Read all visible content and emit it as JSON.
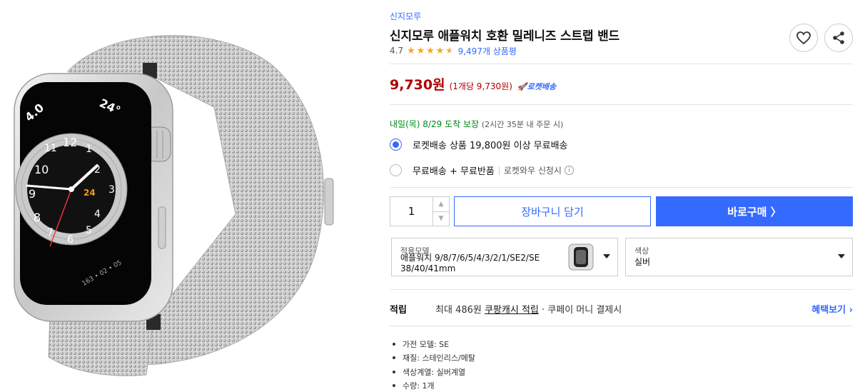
{
  "product": {
    "brand": "신지모루",
    "title": "신지모루 애플워치 호환 밀레니즈 스트랩 밴드",
    "rating": "4.7",
    "rating_value": 4.7,
    "review_count": "9,497개 상품평",
    "price": "9,730원",
    "unit_price": "(1개당 9,730원)",
    "rocket_badge": "로켓배송"
  },
  "delivery": {
    "date": "내일(목) 8/29",
    "guarantee": "도착 보장",
    "note": "(2시간 35분 내 주문 시)"
  },
  "shipping_options": [
    {
      "label": "로켓배송 상품 19,800원 이상 무료배송",
      "selected": true
    },
    {
      "label": "무료배송 + 무료반품",
      "extra": "로켓와우 신청시",
      "selected": false
    }
  ],
  "purchase": {
    "quantity": "1",
    "cart_label": "장바구니 담기",
    "buy_label": "바로구매 〉"
  },
  "options": {
    "model": {
      "label": "적용모델",
      "value_line1": "애플워치 9/8/7/6/5/4/3/2/1/SE2/SE",
      "value_line2": "38/40/41mm"
    },
    "color": {
      "label": "색상",
      "value": "실버"
    }
  },
  "benefit": {
    "label": "적립",
    "text_prefix": "최대 486원 ",
    "text_link": "쿠팡캐시 적립",
    "text_suffix": " · 쿠페이 머니 결제시",
    "more_label": "혜택보기 ›"
  },
  "attributes": [
    "가전 모델: SE",
    "재질: 스테인리스/메탈",
    "색상계열: 실버계열",
    "수량: 1개"
  ],
  "watch_face": {
    "top_left": "4.0",
    "top_right": "24°",
    "numbers": [
      "12",
      "1",
      "2",
      "3",
      "4",
      "5",
      "6",
      "7",
      "8",
      "9",
      "10",
      "11"
    ],
    "highlight": "24",
    "bottom": "163 • 02 • 05"
  },
  "colors": {
    "accent": "#346aff",
    "price": "#ae0000",
    "delivery_green": "#00891a",
    "star": "#f5a623"
  }
}
